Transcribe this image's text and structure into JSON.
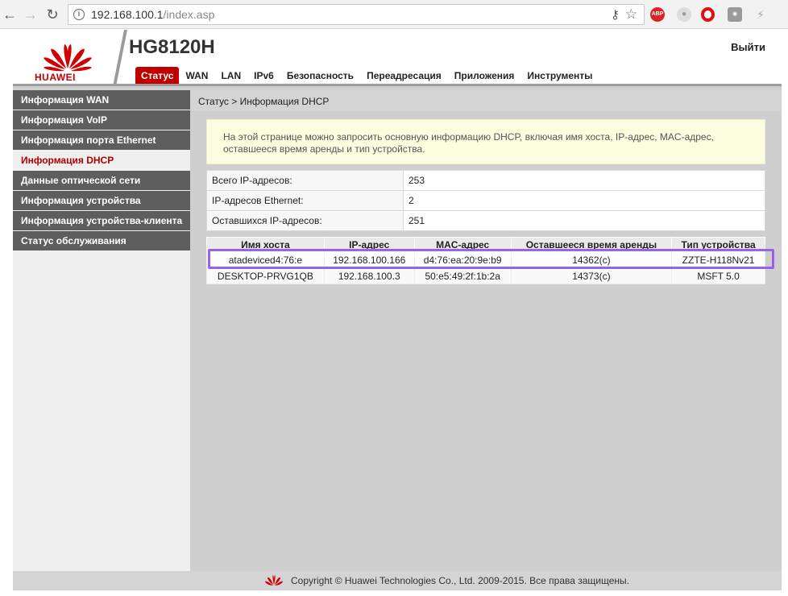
{
  "browser": {
    "url_host": "192.168.100.1",
    "url_path": "/index.asp",
    "ext_abp_label": "ABP"
  },
  "header": {
    "brand": "HUAWEI",
    "model": "HG8120H",
    "logout": "Выйти",
    "tabs": [
      {
        "label": "Статус",
        "active": true
      },
      {
        "label": "WAN"
      },
      {
        "label": "LAN"
      },
      {
        "label": "IPv6"
      },
      {
        "label": "Безопасность"
      },
      {
        "label": "Переадресация"
      },
      {
        "label": "Приложения"
      },
      {
        "label": "Инструменты"
      }
    ]
  },
  "sidebar": {
    "items": [
      {
        "label": "Информация WAN"
      },
      {
        "label": "Информация VoIP"
      },
      {
        "label": "Информация порта Ethernet"
      },
      {
        "label": "Информация DHCP",
        "active": true
      },
      {
        "label": "Данные оптической сети"
      },
      {
        "label": "Информация устройства"
      },
      {
        "label": "Информация устройства-клиента"
      },
      {
        "label": "Статус обслуживания"
      }
    ]
  },
  "breadcrumb": "Статус > Информация DHCP",
  "notice": "На этой странице можно запросить основную информацию DHCP, включая имя хоста, IP-адрес, MAC-адрес, оставшееся время аренды и тип устройства.",
  "stats": [
    {
      "label": "Всего IP-адресов:",
      "value": "253"
    },
    {
      "label": "IP-адресов Ethernet:",
      "value": "2"
    },
    {
      "label": "Оставшихся IP-адресов:",
      "value": "251"
    }
  ],
  "hosts": {
    "columns": [
      "Имя хоста",
      "IP-адрес",
      "MAC-адрес",
      "Оставшееся время аренды",
      "Тип устройства"
    ],
    "rows": [
      [
        "atadeviced4:76:e",
        "192.168.100.166",
        "d4:76:ea:20:9e:b9",
        "14362(с)",
        "ZZTE-H118Nv21"
      ],
      [
        "DESKTOP-PRVG1QB",
        "192.168.100.3",
        "50:e5:49:2f:1b:2a",
        "14373(с)",
        "MSFT 5.0"
      ]
    ]
  },
  "footer": "Copyright © Huawei Technologies Co., Ltd. 2009-2015. Все права защищены.",
  "colors": {
    "brand_red": "#c00000",
    "sidebar_gray": "#5e5e5e",
    "highlight_purple": "#9b62e8"
  }
}
